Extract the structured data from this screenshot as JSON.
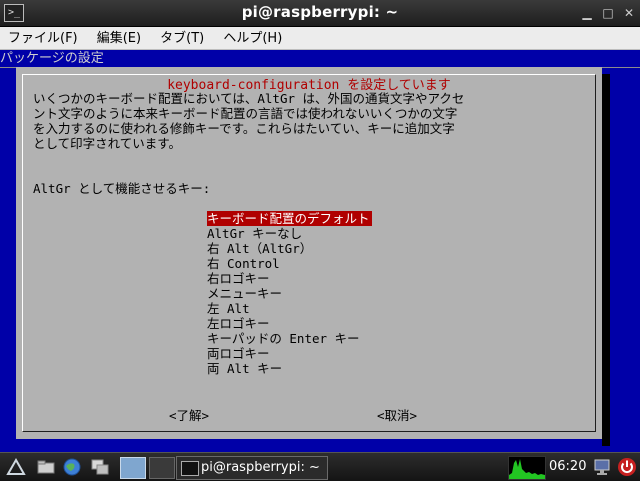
{
  "window": {
    "title": "pi@raspberrypi: ~",
    "icon_label": ">_",
    "controls": [
      "minimize",
      "maximize",
      "close"
    ]
  },
  "menubar": {
    "items": [
      {
        "label": "ファイル(F)"
      },
      {
        "label": "編集(E)"
      },
      {
        "label": "タブ(T)"
      },
      {
        "label": "ヘルプ(H)"
      }
    ]
  },
  "terminal": {
    "screen_title": "パッケージの設定",
    "background_color": "#0000a8"
  },
  "dialog": {
    "title": "keyboard-configuration を設定しています",
    "description": "いくつかのキーボード配置においては、AltGr は、外国の通貨文字やアクセ\nント文字のように本来キーボード配置の言語では使われないいくつかの文字\nを入力するのに使われる修飾キーです。これらはたいてい、キーに追加文字\nとして印字されています。",
    "prompt": "AltGr として機能させるキー:",
    "selected_index": 0,
    "options": [
      "キーボード配置のデフォルト",
      "AltGr キーなし",
      "右 Alt（AltGr）",
      "右 Control",
      "右ロゴキー",
      "メニューキー",
      "左 Alt",
      "左ロゴキー",
      "キーパッドの Enter キー",
      "両ロゴキー",
      "両 Alt キー"
    ],
    "ok_label": "<了解>",
    "cancel_label": "<取消>",
    "highlight_color": "#b00000"
  },
  "taskbar": {
    "launchers": [
      "menu-icon",
      "file-manager-icon",
      "web-browser-icon",
      "desktop-switcher-icon"
    ],
    "active_task": "pi@raspberrypi: ~",
    "clock": "06:20",
    "tray": [
      "cpu-monitor",
      "network-icon",
      "power-icon"
    ]
  }
}
